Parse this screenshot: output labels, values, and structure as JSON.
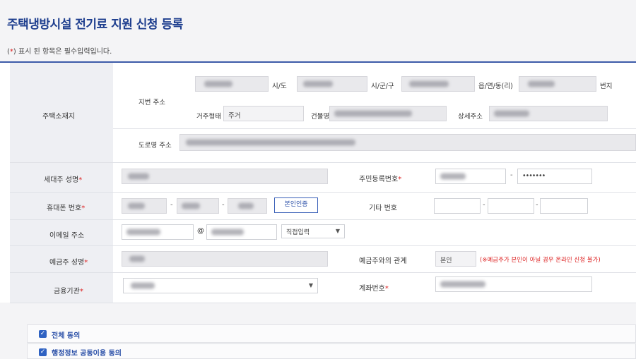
{
  "page": {
    "title": "주택냉방시설 전기료 지원 신청 등록",
    "required_note_prefix": "(",
    "required_note_star": "*",
    "required_note_suffix": ") 표시 된 항목은 필수입력입니다."
  },
  "address": {
    "section_label": "주택소재지",
    "jibun_label": "지번 주소",
    "sido_label": "시/도",
    "sigungu_label": "시/군/구",
    "eupmyeon_label": "읍/면/동(리)",
    "bunji_label": "번지",
    "housing_type_label": "거주형태",
    "housing_type_value": "주거",
    "building_label": "건물명",
    "detail_label": "상세주소",
    "road_label": "도로명 주소"
  },
  "applicant": {
    "name_label": "세대주 성명",
    "rrn_label": "주민등록번호",
    "rrn_back_value": "•••••••",
    "phone_label": "휴대폰 번호",
    "verify_button": "본인인증",
    "other_phone_label": "기타 번호",
    "email_label": "이메일 주소",
    "email_at": "@",
    "email_domain_select": "직접입력"
  },
  "account": {
    "holder_label": "예금주 성명",
    "relation_label": "예금주와의 관계",
    "relation_value": "본인",
    "relation_warning": "(※예금주가 본인이 아닐 경우 온라인 신청 불가)",
    "bank_label": "금융기관",
    "account_no_label": "계좌번호"
  },
  "agreements": {
    "all_label": "전체 동의",
    "admin_info_label": "행정정보 공동이용 동의"
  },
  "common": {
    "star": "*",
    "dash": "-"
  },
  "colors": {
    "accent": "#1f3f8f",
    "required": "#dd2222",
    "checkbox": "#2f62c2"
  }
}
